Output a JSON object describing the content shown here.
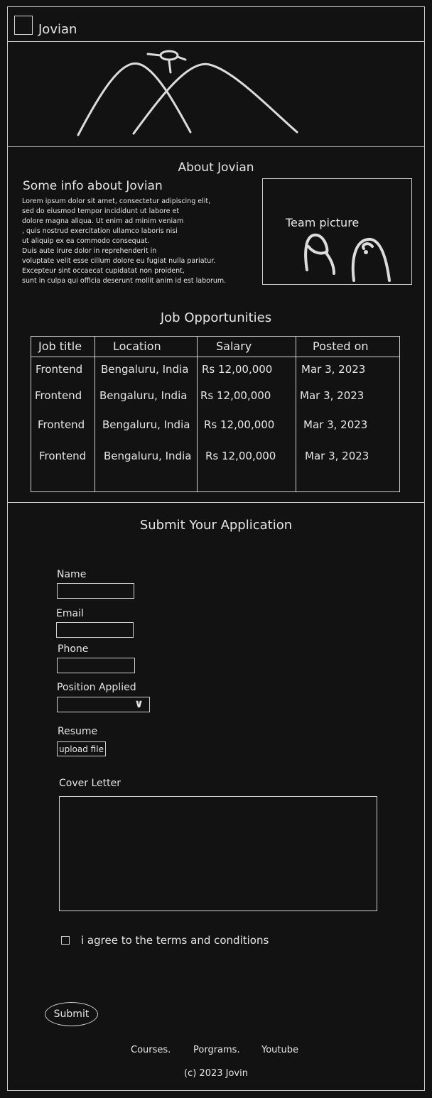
{
  "header": {
    "brand": "Jovian",
    "logo_icon": "image-placeholder-icon"
  },
  "hero": {
    "image": "mountains-sun-sketch"
  },
  "about": {
    "title": "About Jovian",
    "subtitle": "Some info about Jovian",
    "body": "Lorem ipsum dolor sit amet, consectetur adipiscing elit,\nsed do eiusmod tempor incididunt ut labore et\n dolore magna aliqua. Ut enim ad minim veniam\n, quis nostrud exercitation ullamco laboris nisi\n ut aliquip ex ea commodo consequat.\n Duis aute irure dolor in reprehenderit in\n voluptate velit esse cillum dolore eu fugiat nulla pariatur.\nExcepteur sint occaecat cupidatat non proident,\nsunt in culpa qui officia deserunt mollit anim id est laborum.",
    "team_picture_label": "Team picture"
  },
  "jobs": {
    "title": "Job Opportunities",
    "columns": [
      "Job title",
      "Location",
      "Salary",
      "Posted on"
    ],
    "rows": [
      [
        "Frontend",
        "Bengaluru, India",
        "Rs 12,00,000",
        "Mar 3, 2023"
      ],
      [
        "Frontend",
        "Bengaluru, India",
        "Rs 12,00,000",
        "Mar 3, 2023"
      ],
      [
        "Frontend",
        "Bengaluru, India",
        "Rs 12,00,000",
        "Mar 3, 2023"
      ],
      [
        "Frontend",
        "Bengaluru, India",
        "Rs 12,00,000",
        "Mar 3, 2023"
      ]
    ]
  },
  "form": {
    "title": "Submit Your Application",
    "name_label": "Name",
    "email_label": "Email",
    "phone_label": "Phone",
    "position_label": "Position Applied",
    "position_value": "",
    "resume_label": "Resume",
    "upload_label": "upload file",
    "cover_label": "Cover Letter",
    "agree_label": "i agree to the terms and conditions",
    "submit_label": "Submit"
  },
  "footer": {
    "links": [
      "Courses.",
      "Porgrams.",
      "Youtube"
    ],
    "copyright": "(c) 2023 Jovin"
  }
}
